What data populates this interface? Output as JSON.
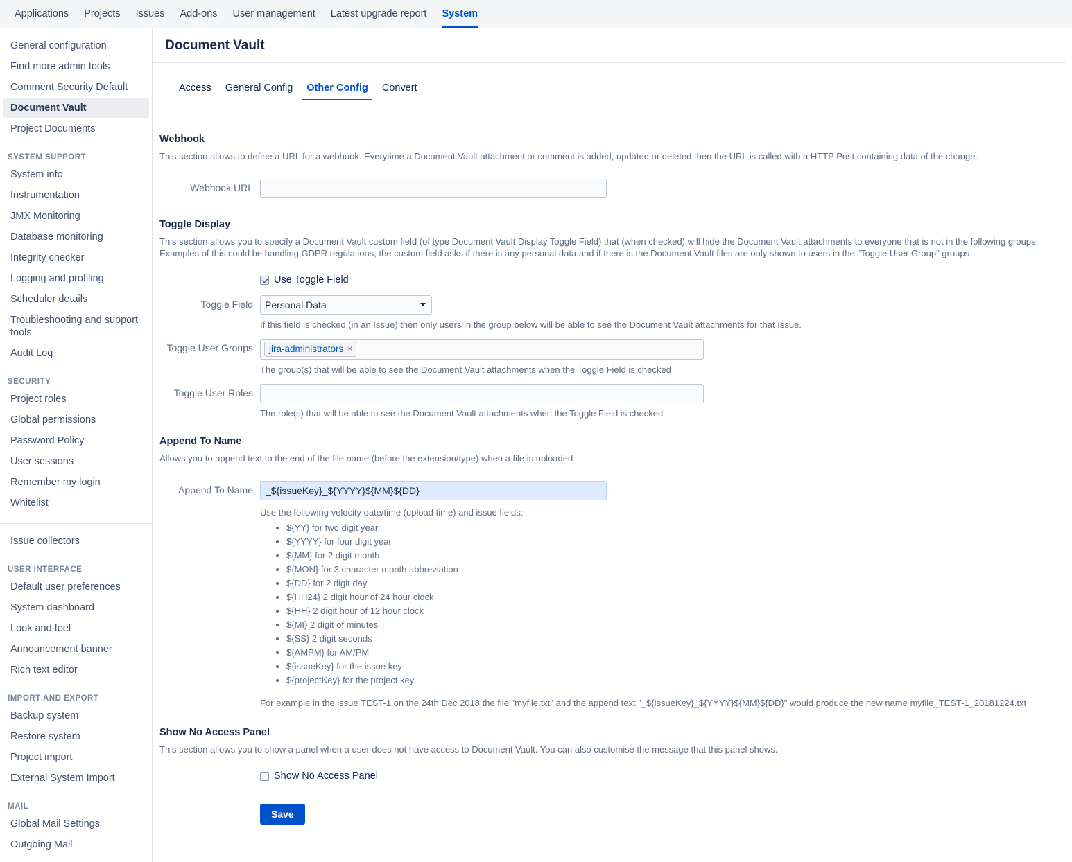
{
  "topnav": {
    "items": [
      {
        "label": "Applications",
        "active": false
      },
      {
        "label": "Projects",
        "active": false
      },
      {
        "label": "Issues",
        "active": false
      },
      {
        "label": "Add-ons",
        "active": false
      },
      {
        "label": "User management",
        "active": false
      },
      {
        "label": "Latest upgrade report",
        "active": false
      },
      {
        "label": "System",
        "active": true
      }
    ]
  },
  "sidebar": {
    "items": [
      {
        "label": "General configuration"
      },
      {
        "label": "Find more admin tools"
      },
      {
        "label": "Comment Security Default"
      },
      {
        "label": "Document Vault"
      },
      {
        "label": "Project Documents"
      }
    ],
    "system_support_heading": "SYSTEM SUPPORT",
    "system_support": [
      {
        "label": "System info"
      },
      {
        "label": "Instrumentation"
      },
      {
        "label": "JMX Monitoring"
      },
      {
        "label": "Database monitoring"
      },
      {
        "label": "Integrity checker"
      },
      {
        "label": "Logging and profiling"
      },
      {
        "label": "Scheduler details"
      },
      {
        "label": "Troubleshooting and support tools"
      },
      {
        "label": "Audit Log"
      }
    ],
    "security_heading": "SECURITY",
    "security": [
      {
        "label": "Project roles"
      },
      {
        "label": "Global permissions"
      },
      {
        "label": "Password Policy"
      },
      {
        "label": "User sessions"
      },
      {
        "label": "Remember my login"
      },
      {
        "label": "Whitelist"
      }
    ],
    "issue_collectors": {
      "label": "Issue collectors"
    },
    "user_interface_heading": "USER INTERFACE",
    "user_interface": [
      {
        "label": "Default user preferences"
      },
      {
        "label": "System dashboard"
      },
      {
        "label": "Look and feel"
      },
      {
        "label": "Announcement banner"
      },
      {
        "label": "Rich text editor"
      }
    ],
    "import_export_heading": "IMPORT AND EXPORT",
    "import_export": [
      {
        "label": "Backup system"
      },
      {
        "label": "Restore system"
      },
      {
        "label": "Project import"
      },
      {
        "label": "External System Import"
      }
    ],
    "mail_heading": "MAIL",
    "mail": [
      {
        "label": "Global Mail Settings"
      },
      {
        "label": "Outgoing Mail"
      }
    ]
  },
  "page": {
    "title": "Document Vault",
    "tabs": [
      {
        "label": "Access",
        "active": false
      },
      {
        "label": "General Config",
        "active": false
      },
      {
        "label": "Other Config",
        "active": true
      },
      {
        "label": "Convert",
        "active": false
      }
    ]
  },
  "webhook": {
    "title": "Webhook",
    "description": "This section allows to define a URL for a webhook. Everytime a Document Vault attachment or comment is added, updated or deleted then the URL is called with a HTTP Post containing data of the change.",
    "url_label": "Webhook URL",
    "url_value": "",
    "url_placeholder": ""
  },
  "toggle_display": {
    "title": "Toggle Display",
    "description": "This section allows you to specify a Document Vault custom field (of type Document Vault Display Toggle Field) that (when checked) will hide the Document Vault attachments to everyone that is not in the following groups. Examples of this could be handling GDPR regulations, the custom field asks if there is any personal data and if there is the Document Vault files are only shown to users in the \"Toggle User Group\" groups",
    "use_toggle_label": "Use Toggle Field",
    "use_toggle_checked": true,
    "toggle_field_label": "Toggle Field",
    "toggle_field_value": "Personal Data",
    "toggle_field_options": [
      "Personal Data"
    ],
    "toggle_field_hint": "If this field is checked (in an Issue) then only users in the group below will be able to see the Document Vault attachments for that Issue.",
    "toggle_user_groups_label": "Toggle User Groups",
    "toggle_user_groups_tokens": [
      "jira-administrators"
    ],
    "toggle_user_groups_hint": "The group(s) that will be able to see the Document Vault attachments when the Toggle Field is checked",
    "toggle_user_roles_label": "Toggle User Roles",
    "toggle_user_roles_value": "",
    "toggle_user_roles_hint": "The role(s) that will be able to see the Document Vault attachments when the Toggle Field is checked"
  },
  "append_to_name": {
    "title": "Append To Name",
    "description": "Allows you to append text to the end of the file name (before the extension/type) when a file is uploaded",
    "field_label": "Append To Name",
    "field_value": "_${issueKey}_${YYYY}${MM}${DD}",
    "hint_intro": "Use the following velocity date/time (upload time) and issue fields:",
    "variables": [
      "${YY} for two digit year",
      "${YYYY} for four digit year",
      "${MM} for 2 digit month",
      "${MON} for 3 character month abbreviation",
      "${DD} for 2 digit day",
      "${HH24} 2 digit hour of 24 hour clock",
      "${HH} 2 digit hour of 12 hour clock",
      "${MI} 2 digit of minutes",
      "${SS} 2 digit seconds",
      "${AMPM} for AM/PM",
      "${issueKey} for the issue key",
      "${projectKey} for the project key"
    ],
    "example": "For example in the issue TEST-1 on the 24th Dec 2018 the file \"myfile.txt\" and the append text \"_${issueKey}_${YYYY}${MM}${DD}\" would produce the new name myfile_TEST-1_20181224.txt"
  },
  "no_access_panel": {
    "title": "Show No Access Panel",
    "description": "This section allows you to show a panel when a user does not have access to Document Vault. You can also customise the message that this panel shows.",
    "checkbox_label": "Show No Access Panel",
    "checked": false
  },
  "actions": {
    "save_label": "Save"
  },
  "colors": {
    "accent": "#0052CC",
    "nav_bg": "#F4F5F7",
    "selected_bg": "#EBECF0",
    "focus_bg": "#DEEBFF",
    "text": "#172B4D",
    "muted": "#5E6C84"
  }
}
